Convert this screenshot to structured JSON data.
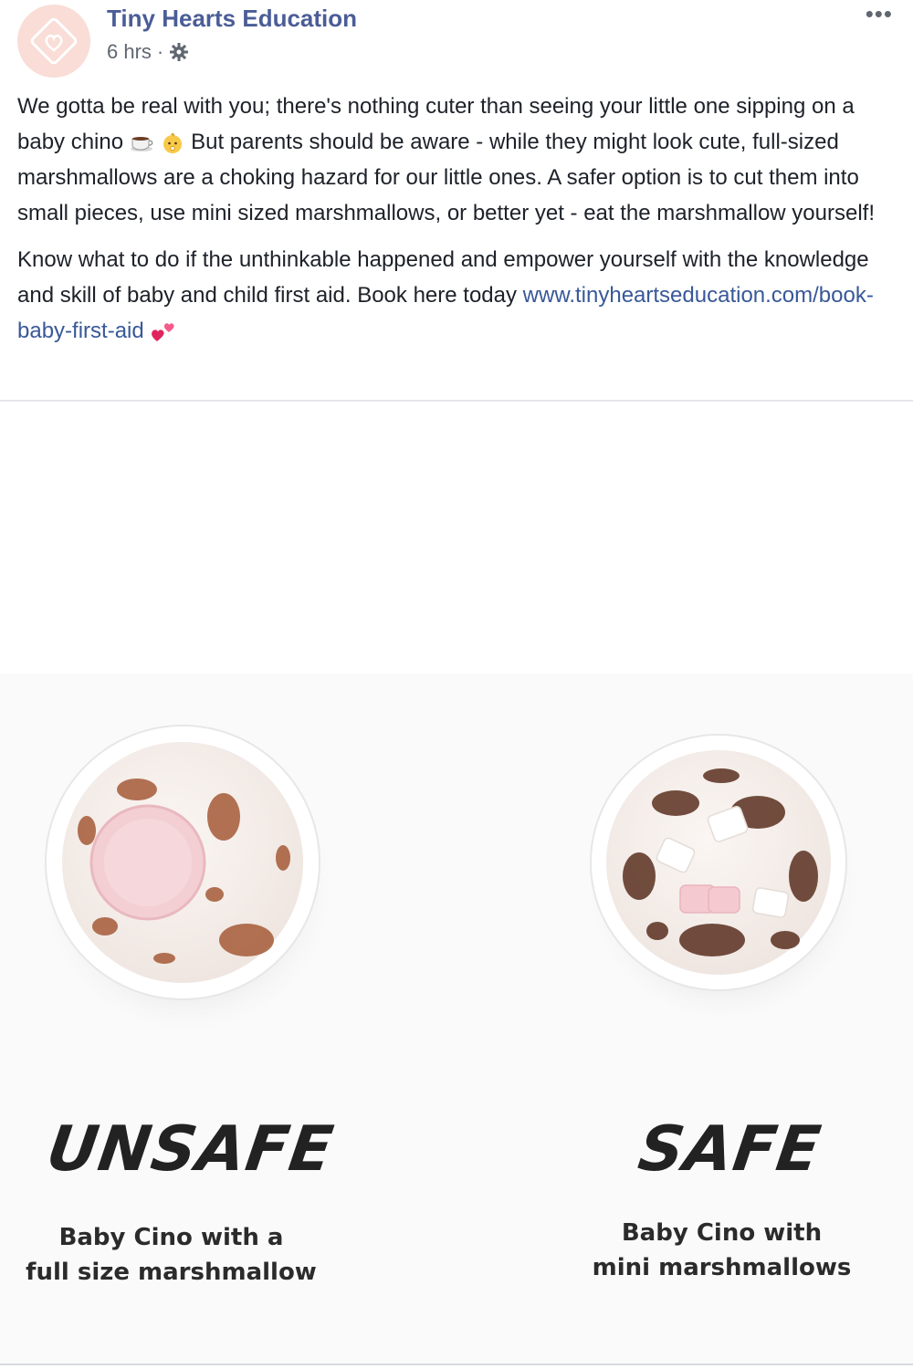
{
  "post": {
    "page_name": "Tiny Hearts Education",
    "time": "6 hrs",
    "separator": "·",
    "more_label": "•••",
    "paragraph1_a": "We gotta be real with you; there's nothing cuter than seeing your little one sipping on a baby chino",
    "paragraph1_b": "But parents should be aware - while they might look cute, full-sized marshmallows are a choking hazard for our little ones. A safer option is to cut them into small pieces, use mini sized marshmallows, or better yet - eat the marshmallow yourself!",
    "paragraph2": "Know what to do if the unthinkable happened and empower yourself with the knowledge and skill of baby and child first aid. Book here today",
    "link": "www.tinyheartseducation.com/book-baby-first-aid",
    "emoji_icons": [
      "coffee-icon",
      "baby-icon",
      "two-hearts-icon"
    ],
    "colors": {
      "page_name": "#4b5d97",
      "link": "#385898",
      "meta": "#606770"
    }
  },
  "image": {
    "left_title": "UNSAFE",
    "left_sub_line1": "Baby Cino with a",
    "left_sub_line2": "full size marshmallow",
    "right_title": "SAFE",
    "right_sub_line1": "Baby Cino with",
    "right_sub_line2": "mini marshmallows"
  }
}
